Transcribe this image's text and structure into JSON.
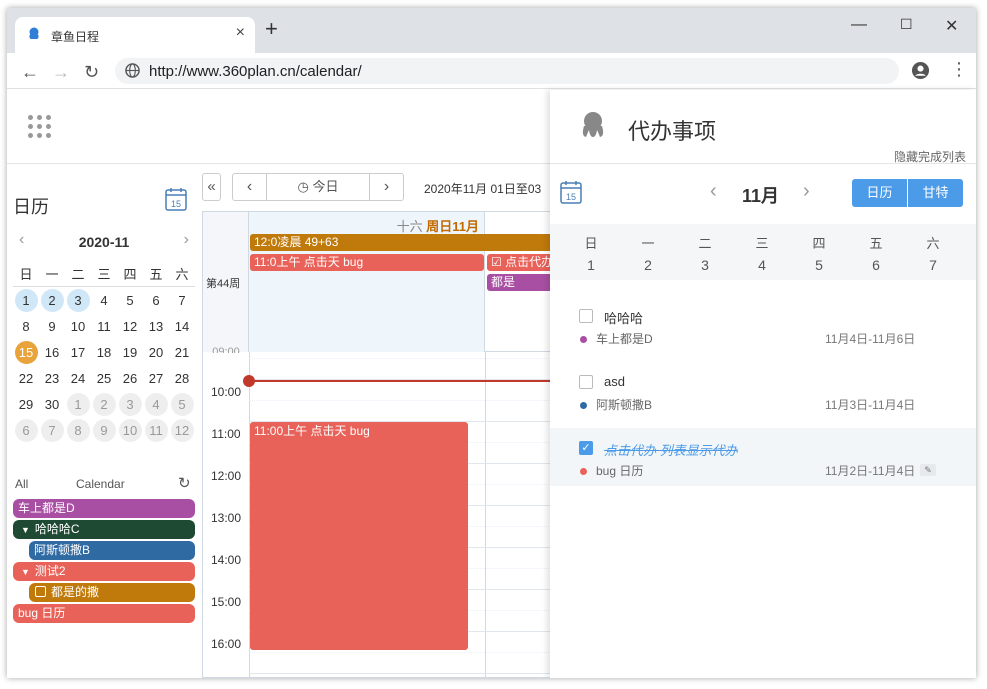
{
  "browser": {
    "tab_title": "章鱼日程",
    "tab_close": "×",
    "new_tab": "+",
    "url": "http://www.360plan.cn/calendar/",
    "min": "—",
    "max": "☐",
    "close": "✕"
  },
  "sidebar": {
    "title": "日历",
    "mini_calendar": {
      "month": "2020-11",
      "prev": "‹",
      "next": "›",
      "weekdays": [
        "日",
        "一",
        "二",
        "三",
        "四",
        "五",
        "六"
      ],
      "weeks": [
        [
          "1",
          "2",
          "3",
          "4",
          "5",
          "6",
          "7"
        ],
        [
          "8",
          "9",
          "10",
          "11",
          "12",
          "13",
          "14"
        ],
        [
          "15",
          "16",
          "17",
          "18",
          "19",
          "20",
          "21"
        ],
        [
          "22",
          "23",
          "24",
          "25",
          "26",
          "27",
          "28"
        ],
        [
          "29",
          "30",
          "1",
          "2",
          "3",
          "4",
          "5"
        ],
        [
          "6",
          "7",
          "8",
          "9",
          "10",
          "11",
          "12"
        ]
      ]
    },
    "calendar_bar": {
      "all": "All",
      "label": "Calendar",
      "refresh": "↻"
    },
    "calendars": [
      {
        "label": "车上都是D",
        "color": "#a94fa3"
      },
      {
        "label": "哈哈哈C",
        "color": "#1e4a34"
      },
      {
        "label": "阿斯顿撒B",
        "color": "#2f6aa3"
      },
      {
        "label": "测试2",
        "color": "#e8625a"
      },
      {
        "label": "都是的撒",
        "color": "#c07a0b"
      },
      {
        "label": "bug 日历",
        "color": "#e8625a"
      }
    ]
  },
  "toolbar": {
    "collapse": "«",
    "prev": "‹",
    "today": "今日",
    "next": "›",
    "range": "2020年11月 01日至03"
  },
  "week_view": {
    "week_label": "第44周",
    "day_lunar": "十六",
    "day_name": "周日11月",
    "allday_events": [
      {
        "label": "12:0凌晨 49+63",
        "color": "#c07a0b"
      },
      {
        "label": "11:0上午 点击天 bug",
        "color": "#e8625a"
      },
      {
        "label": "☑ 点击代办",
        "color": "#e8625a"
      },
      {
        "label": "都是",
        "color": "#a94fa3"
      }
    ],
    "cut_time": "09:00",
    "times": [
      "10:00",
      "11:00",
      "12:00",
      "13:00",
      "14:00",
      "15:00",
      "16:00"
    ],
    "timed_event": {
      "label": "11:00上午 点击天 bug",
      "color": "#e8625a"
    }
  },
  "panel": {
    "title": "代办事项",
    "hide_completed": "隐藏完成列表",
    "month": "11月",
    "prev": "‹",
    "next": "›",
    "view_day": "日历",
    "view_gantt": "甘特",
    "weekdays": [
      "日",
      "一",
      "二",
      "三",
      "四",
      "五",
      "六"
    ],
    "days": [
      "1",
      "2",
      "3",
      "4",
      "5",
      "6",
      "7"
    ],
    "todos": [
      {
        "title": "哈哈哈",
        "calendar": "车上都是D",
        "dot": "#a94fa3",
        "date": "11月4日-11月6日",
        "done": false
      },
      {
        "title": "asd",
        "calendar": "阿斯顿撒B",
        "dot": "#2f6aa3",
        "date": "11月3日-11月4日",
        "done": false
      },
      {
        "title": "点击代办 列表显示代办",
        "calendar": "bug 日历",
        "dot": "#e8625a",
        "date": "11月2日-11月4日",
        "done": true
      }
    ]
  }
}
